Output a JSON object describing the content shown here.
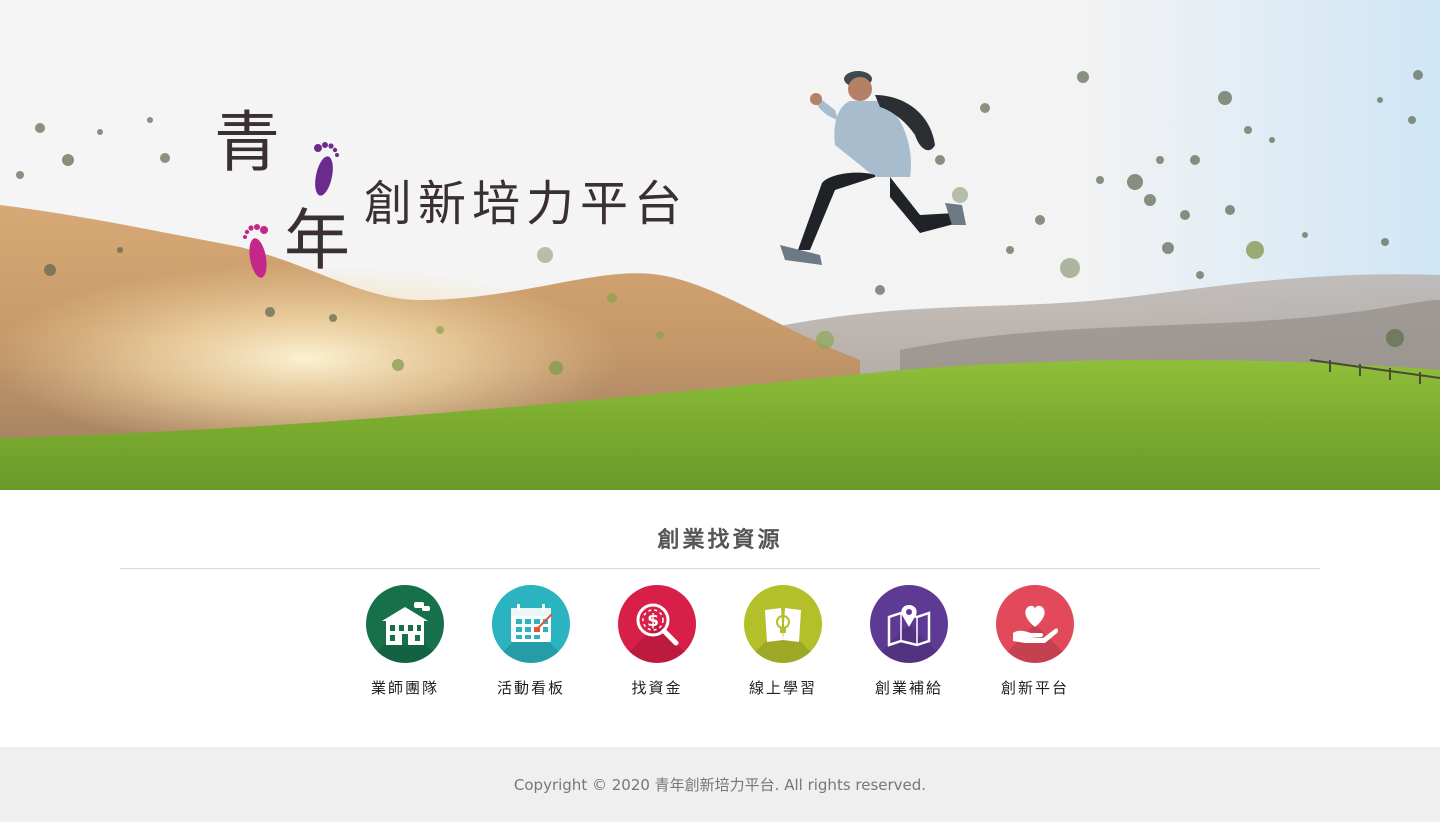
{
  "hero": {
    "logo_char_1": "青",
    "logo_char_2": "年",
    "tagline": "創新培力平台",
    "foot_color_1": "#6a2b8c",
    "foot_color_2": "#c4268a"
  },
  "resources": {
    "title": "創業找資源",
    "items": [
      {
        "label": "業師團隊",
        "icon": "mentor-building-icon",
        "color": "#16704a"
      },
      {
        "label": "活動看板",
        "icon": "calendar-icon",
        "color": "#2bb3c0"
      },
      {
        "label": "找資金",
        "icon": "funding-dollar-icon",
        "color": "#d81f47"
      },
      {
        "label": "線上學習",
        "icon": "open-book-lightbulb-icon",
        "color": "#b3c02a"
      },
      {
        "label": "創業補給",
        "icon": "map-pin-icon",
        "color": "#5f3a94"
      },
      {
        "label": "創新平台",
        "icon": "heart-hand-icon",
        "color": "#e24a5c"
      }
    ]
  },
  "footer": {
    "copyright": "Copyright © 2020 青年創新培力平台. All rights reserved."
  }
}
